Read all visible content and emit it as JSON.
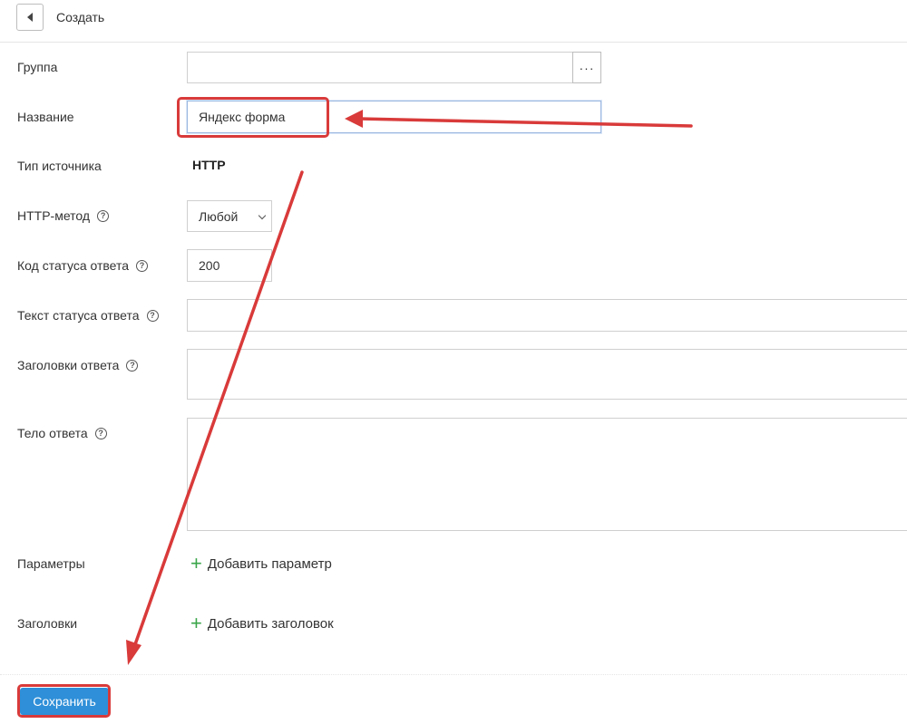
{
  "header": {
    "title": "Создать",
    "back_icon": "back-arrow-icon"
  },
  "form": {
    "group": {
      "label": "Группа",
      "value": "",
      "picker_label": "···"
    },
    "name": {
      "label": "Название",
      "value": "Яндекс форма"
    },
    "source_type": {
      "label": "Тип источника",
      "value": "HTTP"
    },
    "http_method": {
      "label": "HTTP-метод",
      "help": "?",
      "value": "Любой"
    },
    "status_code": {
      "label": "Код статуса ответа",
      "help": "?",
      "value": "200"
    },
    "status_text": {
      "label": "Текст статуса ответа",
      "help": "?",
      "value": ""
    },
    "response_headers": {
      "label": "Заголовки ответа",
      "help": "?",
      "value": ""
    },
    "response_body": {
      "label": "Тело ответа",
      "help": "?",
      "value": ""
    },
    "parameters": {
      "label": "Параметры",
      "add_label": "Добавить параметр",
      "add_symbol": "+"
    },
    "headers": {
      "label": "Заголовки",
      "add_label": "Добавить заголовок",
      "add_symbol": "+"
    }
  },
  "footer": {
    "save_label": "Сохранить"
  },
  "colors": {
    "accent": "#2f8fd8",
    "annotation": "#d93a3a",
    "add_icon": "#3aa54a"
  }
}
